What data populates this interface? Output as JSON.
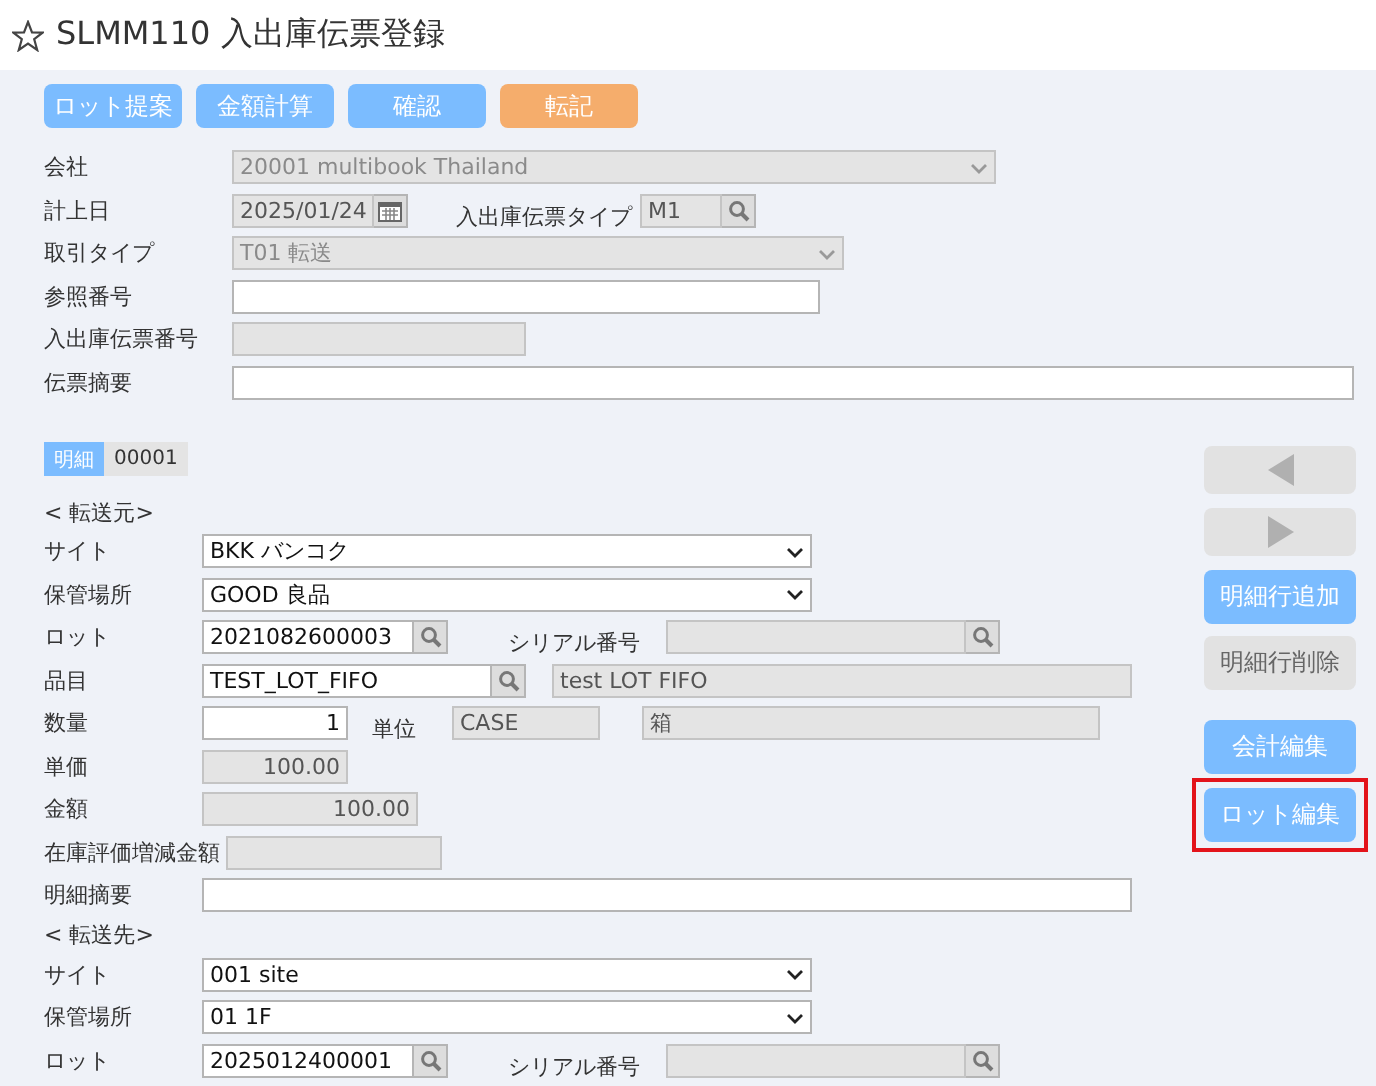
{
  "title": {
    "text": "SLMM110 入出庫伝票登録",
    "favorite": false
  },
  "toolbar": [
    {
      "label": "ロット提案",
      "kind": "primary"
    },
    {
      "label": "金額計算",
      "kind": "primary"
    },
    {
      "label": "確認",
      "kind": "primary"
    },
    {
      "label": "転記",
      "kind": "accent"
    }
  ],
  "header": [
    {
      "label": "会社",
      "fields": [
        {
          "kind": "select",
          "value": "20001 multibook Thailand",
          "disabled": true
        }
      ]
    },
    {
      "label": "計上日",
      "fields": [
        {
          "kind": "date",
          "value": "2025/01/24",
          "disabled": true
        },
        {
          "kind": "label",
          "value": "入出庫伝票タイプ"
        },
        {
          "kind": "lookup",
          "value": "M1",
          "disabled": true
        }
      ]
    },
    {
      "label": "取引タイプ",
      "fields": [
        {
          "kind": "select",
          "value": "T01 転送",
          "disabled": true
        }
      ]
    },
    {
      "label": "参照番号",
      "fields": [
        {
          "kind": "text",
          "disabled": false
        }
      ]
    },
    {
      "label": "入出庫伝票番号",
      "fields": [
        {
          "kind": "text",
          "disabled": true
        }
      ]
    },
    {
      "label": "伝票摘要",
      "fields": [
        {
          "kind": "text",
          "disabled": false
        }
      ]
    }
  ],
  "detail_tabs": [
    {
      "label": "明細",
      "selected": true
    },
    {
      "label": "00001",
      "selected": false
    }
  ],
  "sections": [
    {
      "heading": "< 転送元>",
      "rows": [
        {
          "label": "サイト",
          "fields": [
            {
              "kind": "select",
              "value": "BKK バンコク",
              "disabled": false
            }
          ]
        },
        {
          "label": "保管場所",
          "fields": [
            {
              "kind": "select",
              "value": "GOOD 良品",
              "disabled": false
            }
          ]
        },
        {
          "label": "ロット",
          "fields": [
            {
              "kind": "lookup",
              "value": "2021082600003",
              "disabled": false
            },
            {
              "kind": "label",
              "value": "シリアル番号"
            },
            {
              "kind": "lookup",
              "disabled": true
            }
          ]
        },
        {
          "label": "品目",
          "fields": [
            {
              "kind": "lookup",
              "value": "TEST_LOT_FIFO",
              "disabled": false
            },
            {
              "kind": "text",
              "value": "test LOT FIFO",
              "disabled": true
            }
          ]
        },
        {
          "label": "数量",
          "fields": [
            {
              "kind": "number",
              "value": "1",
              "disabled": false
            },
            {
              "kind": "label",
              "value": "単位"
            },
            {
              "kind": "text",
              "value": "CASE",
              "disabled": true
            },
            {
              "kind": "text",
              "value": "箱",
              "disabled": true
            }
          ]
        },
        {
          "label": "単価",
          "fields": [
            {
              "kind": "number",
              "value": "100.00",
              "disabled": true
            }
          ]
        },
        {
          "label": "金額",
          "fields": [
            {
              "kind": "number",
              "value": "100.00",
              "disabled": true
            }
          ]
        },
        {
          "label": "在庫評価増減金額",
          "fields": [
            {
              "kind": "number",
              "disabled": true
            }
          ]
        },
        {
          "label": "明細摘要",
          "fields": [
            {
              "kind": "text",
              "disabled": false
            }
          ]
        }
      ]
    },
    {
      "heading": "< 転送先>",
      "rows": [
        {
          "label": "サイト",
          "fields": [
            {
              "kind": "select",
              "value": "001 site",
              "disabled": false
            }
          ]
        },
        {
          "label": "保管場所",
          "fields": [
            {
              "kind": "select",
              "value": "01 1F",
              "disabled": false
            }
          ]
        },
        {
          "label": "ロット",
          "fields": [
            {
              "kind": "lookup",
              "value": "2025012400001",
              "disabled": false
            },
            {
              "kind": "label",
              "value": "シリアル番号"
            },
            {
              "kind": "lookup",
              "disabled": true
            }
          ]
        }
      ]
    }
  ],
  "side_buttons": [
    {
      "kind": "prev",
      "disabled": true,
      "highlighted": false
    },
    {
      "kind": "next",
      "disabled": true,
      "highlighted": false
    },
    {
      "kind": "action",
      "label": "明細行追加",
      "disabled": false,
      "highlighted": false
    },
    {
      "kind": "action",
      "label": "明細行削除",
      "disabled": true,
      "highlighted": false
    },
    {
      "kind": "action",
      "label": "会計編集",
      "disabled": false,
      "highlighted": false
    },
    {
      "kind": "action",
      "label": "ロット編集",
      "disabled": false,
      "highlighted": true
    }
  ]
}
